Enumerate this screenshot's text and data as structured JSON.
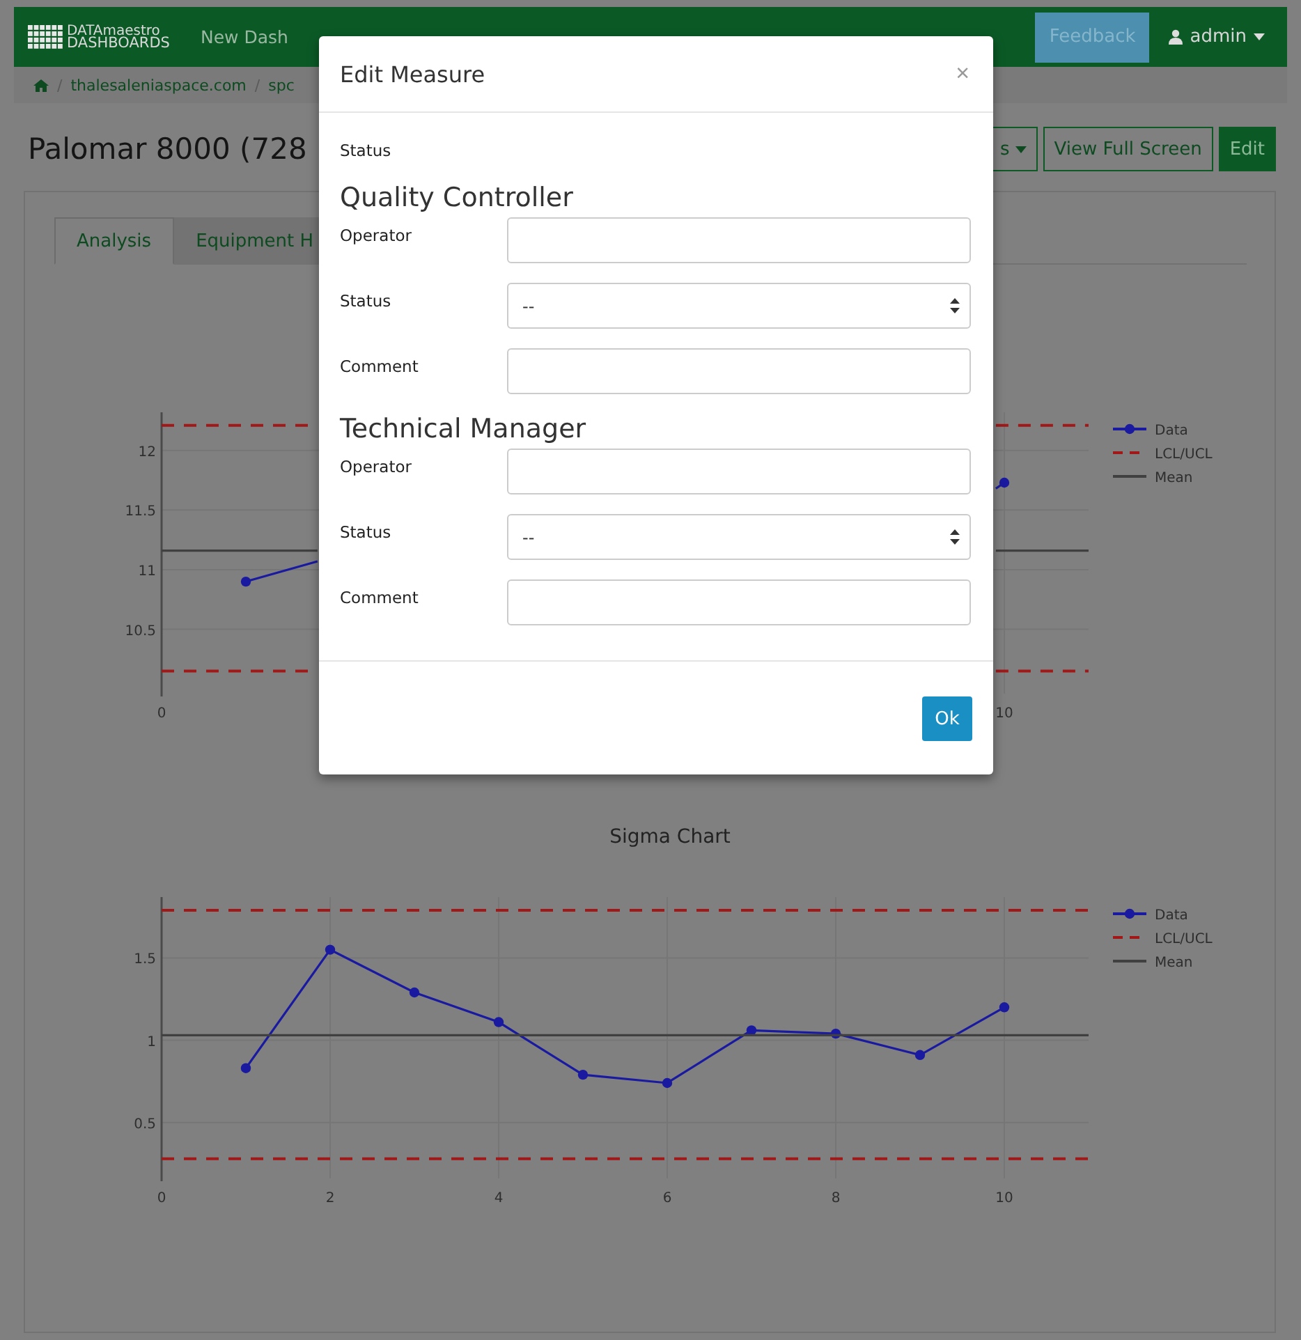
{
  "navbar": {
    "logo_top": "DATAmaestro",
    "logo_bottom": "DASHBOARDS",
    "link": "New Dash",
    "feedback": "Feedback",
    "user": "admin"
  },
  "breadcrumb": {
    "separator": "/",
    "items": [
      "thalesaleniaspace.com",
      "spc"
    ]
  },
  "page": {
    "title": "Palomar 8000 (728",
    "buttons": [
      {
        "label": "s",
        "kind": "dropdown"
      },
      {
        "label": "View Full Screen",
        "kind": "outline"
      },
      {
        "label": "Edit",
        "kind": "solid"
      }
    ]
  },
  "tabs": [
    {
      "label": "Analysis",
      "selected": true
    },
    {
      "label": "Equipment H",
      "selected": false
    }
  ],
  "charts": [
    {
      "chart_data": {
        "type": "line",
        "grid": true,
        "legend": "right",
        "x": [
          0,
          1,
          1.85,
          9.9,
          10,
          11
        ],
        "xlim": [
          0,
          11
        ],
        "ylim": [
          9.96,
          12.32
        ],
        "xticks": [
          0,
          10
        ],
        "yticks": [
          10.5,
          11,
          11.5,
          12
        ],
        "series": [
          {
            "name": "Data",
            "color": "#1a1aa0",
            "marker": true,
            "line_style": "solid",
            "values": [
              null,
              10.9,
              11.07,
              11.68,
              11.73,
              null
            ]
          },
          {
            "name": "LCL/UCL",
            "color": "#a01818",
            "line_style": "dashed",
            "values": [
              12.21,
              12.21,
              12.21,
              12.21,
              12.21,
              12.21
            ]
          },
          {
            "color": "#a01818",
            "line_style": "dashed",
            "values": [
              10.15,
              10.15,
              10.15,
              10.15,
              10.15,
              10.15
            ]
          },
          {
            "name": "Mean",
            "color": "#404040",
            "line_style": "solid",
            "values": [
              11.16,
              11.16,
              11.16,
              11.16,
              11.16,
              11.16
            ]
          }
        ]
      }
    },
    {
      "chart_data": {
        "type": "line",
        "grid": true,
        "legend": "right",
        "title": "Sigma Chart",
        "x": [
          0,
          1,
          2,
          3,
          4,
          5,
          6,
          7,
          8,
          9,
          10,
          11
        ],
        "xlim": [
          0,
          11
        ],
        "ylim": [
          0.16,
          1.87
        ],
        "xticks": [
          0,
          2,
          4,
          6,
          8,
          10
        ],
        "yticks": [
          0.5,
          1,
          1.5
        ],
        "series": [
          {
            "name": "Data",
            "color": "#1a1aa0",
            "marker": true,
            "line_style": "solid",
            "values": [
              null,
              0.83,
              1.55,
              1.29,
              1.11,
              0.79,
              0.74,
              1.06,
              1.04,
              0.91,
              1.2,
              null
            ]
          },
          {
            "name": "LCL/UCL",
            "color": "#a01818",
            "line_style": "dashed",
            "values": [
              1.79,
              1.79,
              1.79,
              1.79,
              1.79,
              1.79,
              1.79,
              1.79,
              1.79,
              1.79,
              1.79,
              1.79
            ]
          },
          {
            "color": "#a01818",
            "line_style": "dashed",
            "values": [
              0.28,
              0.28,
              0.28,
              0.28,
              0.28,
              0.28,
              0.28,
              0.28,
              0.28,
              0.28,
              0.28,
              0.28
            ]
          },
          {
            "name": "Mean",
            "color": "#404040",
            "line_style": "solid",
            "values": [
              1.03,
              1.03,
              1.03,
              1.03,
              1.03,
              1.03,
              1.03,
              1.03,
              1.03,
              1.03,
              1.03,
              1.03
            ]
          }
        ]
      }
    }
  ],
  "modal": {
    "title": "Edit Measure",
    "close": "×",
    "status_label": "Status",
    "sections": [
      {
        "heading": "Quality Controller",
        "fields": [
          {
            "label": "Operator",
            "kind": "text"
          },
          {
            "label": "Status",
            "kind": "select",
            "value": "--"
          },
          {
            "label": "Comment",
            "kind": "text"
          }
        ]
      },
      {
        "heading": "Technical Manager",
        "fields": [
          {
            "label": "Operator",
            "kind": "text"
          },
          {
            "label": "Status",
            "kind": "select",
            "value": "--"
          },
          {
            "label": "Comment",
            "kind": "text"
          }
        ]
      }
    ],
    "ok": "Ok"
  }
}
